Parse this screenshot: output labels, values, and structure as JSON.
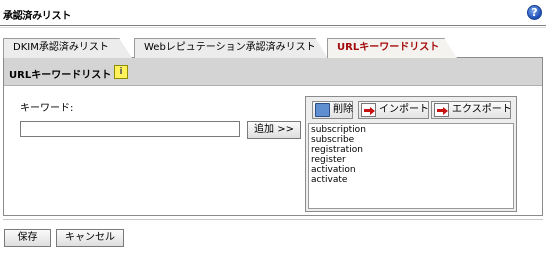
{
  "page": {
    "title": "承認済みリスト",
    "help_icon": "?"
  },
  "tabs": [
    {
      "label": "DKIM承認済みリスト",
      "active": false
    },
    {
      "label": "Webレピュテーション承認済みリスト",
      "active": false
    },
    {
      "label": "URLキーワードリスト",
      "active": true
    }
  ],
  "panel": {
    "title": "URLキーワードリスト",
    "info_icon": "i"
  },
  "keyword": {
    "label": "キーワード:",
    "value": "",
    "add_label": "追加 >>"
  },
  "list_toolbar": {
    "delete_label": "削除",
    "import_label": "インポート",
    "export_label": "エクスポート"
  },
  "keywords": [
    "subscription",
    "subscribe",
    "registration",
    "register",
    "activation",
    "activate"
  ],
  "footer": {
    "save_label": "保存",
    "cancel_label": "キャンセル"
  },
  "colors": {
    "active_tab_text": "#a40b0b",
    "panel_header": "#d4d4d4",
    "help_icon": "#1c4fb5"
  }
}
